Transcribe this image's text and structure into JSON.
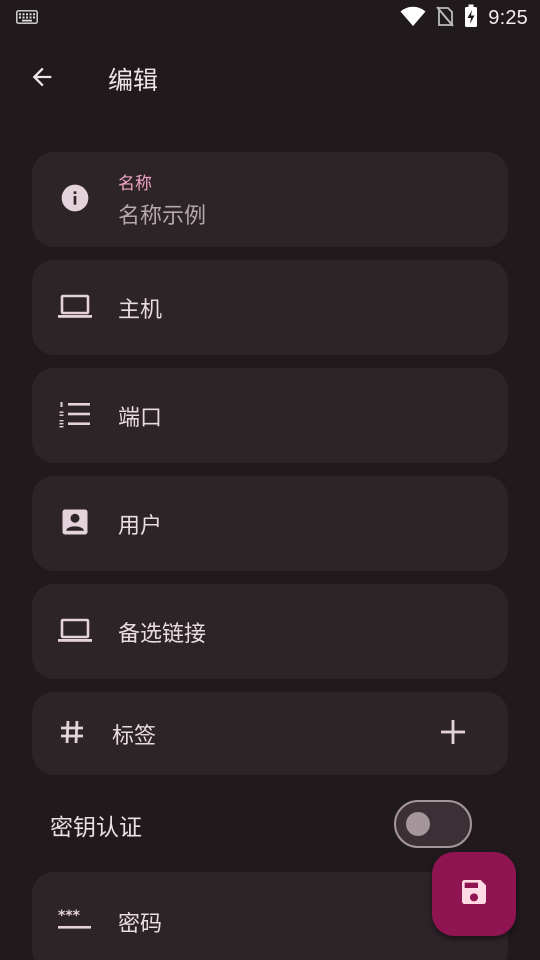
{
  "status_bar": {
    "time": "9:25",
    "icons": [
      "keyboard-icon",
      "wifi-icon",
      "no-sim-icon",
      "battery-charging-icon"
    ]
  },
  "appbar": {
    "title": "编辑",
    "back_icon": "arrow-back-icon"
  },
  "form": {
    "name": {
      "label": "名称",
      "placeholder": "名称示例",
      "icon": "info-icon"
    },
    "host": {
      "label": "主机",
      "icon": "laptop-icon"
    },
    "port": {
      "label": "端口",
      "icon": "numbered-list-icon"
    },
    "user": {
      "label": "用户",
      "icon": "account-box-icon"
    },
    "alt_link": {
      "label": "备选链接",
      "icon": "laptop-icon"
    },
    "tags": {
      "label": "标签",
      "icon": "hashtag-icon",
      "add_icon": "plus-icon"
    },
    "key_auth": {
      "label": "密钥认证",
      "enabled": false
    },
    "password": {
      "label": "密码",
      "icon": "password-icon"
    }
  },
  "fab": {
    "icon": "save-icon"
  },
  "colors": {
    "background": "#201a1d",
    "card": "#2d2428",
    "accent_label": "#f0a3c2",
    "fab": "#8e1452"
  }
}
